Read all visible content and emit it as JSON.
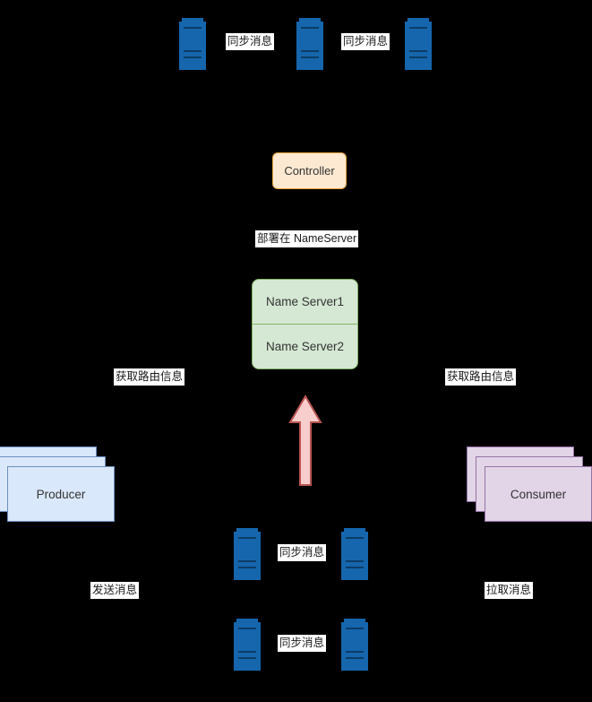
{
  "diagram": {
    "title": "RocketMQ Controller / NameServer topology",
    "background_color": "#000000",
    "colors": {
      "server_icon": "#1566ad",
      "server_icon_bar": "#0c3c66",
      "controller_fill": "#fde9d2",
      "controller_stroke": "#e8a33d",
      "nameserver_fill": "#d5e8d4",
      "nameserver_stroke": "#82b366",
      "producer_fill": "#dae8fc",
      "producer_stroke": "#6c8ebf",
      "consumer_fill": "#e1d5e7",
      "consumer_stroke": "#9673a6",
      "arrow_fill": "#f8cecc",
      "arrow_stroke": "#b85450",
      "label_bg": "#ffffff",
      "label_text": "#1a1a1a"
    }
  },
  "top_row": {
    "servers": [
      {
        "name": "broker-server-top-1"
      },
      {
        "name": "broker-server-top-2"
      },
      {
        "name": "broker-server-top-3"
      }
    ],
    "labels": [
      {
        "text": "同步消息"
      },
      {
        "text": "同步消息"
      }
    ]
  },
  "controller": {
    "label": "Controller"
  },
  "deploy_note": {
    "text": "部署在 NameServer"
  },
  "nameservers": [
    {
      "label": "Name Server1"
    },
    {
      "label": "Name Server2"
    }
  ],
  "route_labels": {
    "left": "获取路由信息",
    "right": "获取路由信息"
  },
  "producer": {
    "label": "Producer",
    "action_label": "发送消息"
  },
  "consumer": {
    "label": "Consumer",
    "action_label": "拉取消息"
  },
  "bottom_rows": [
    {
      "servers": [
        {
          "name": "broker-server-mid-left"
        },
        {
          "name": "broker-server-mid-right"
        }
      ],
      "label": "同步消息"
    },
    {
      "servers": [
        {
          "name": "broker-server-bottom-left"
        },
        {
          "name": "broker-server-bottom-right"
        }
      ],
      "label": "同步消息"
    }
  ],
  "arrow": {
    "name": "upward-arrow",
    "direction": "up"
  }
}
